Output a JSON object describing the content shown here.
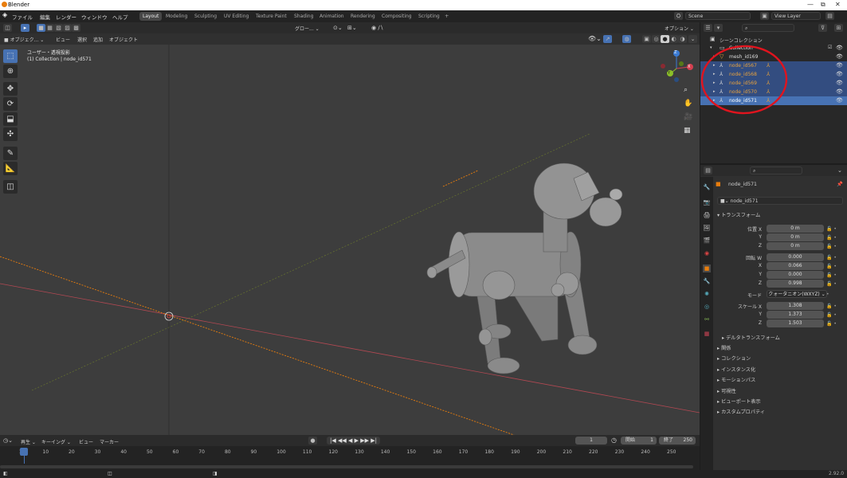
{
  "window": {
    "title": "Blender",
    "minimize": "—",
    "restore": "⧉",
    "close": "✕"
  },
  "menubar": {
    "menus": [
      "ファイル",
      "編集",
      "レンダー",
      "ウィンドウ",
      "ヘルプ"
    ],
    "workspaces": [
      "Layout",
      "Modeling",
      "Sculpting",
      "UV Editing",
      "Texture Paint",
      "Shading",
      "Animation",
      "Rendering",
      "Compositing",
      "Scripting"
    ],
    "add_workspace": "+",
    "scene_label": "Scene",
    "view_layer_label": "View Layer"
  },
  "viewport_header": {
    "mode": "オブジェク...",
    "transform_orientation": "グロー...",
    "overlay_label": "オプション"
  },
  "viewport_menu": {
    "items": [
      "ビュー",
      "選択",
      "追加",
      "オブジェクト"
    ]
  },
  "viewport": {
    "view_name": "ユーザー・透視投影",
    "collection_info": "(1) Collection | node_id571",
    "gizmo_x": "X",
    "gizmo_y": "Y",
    "gizmo_z": "Z"
  },
  "tools": [
    "select-box-icon",
    "cursor-icon",
    "move-icon",
    "rotate-icon",
    "scale-icon",
    "transform-icon",
    "annotate-icon",
    "measure-icon",
    "add-cube-icon"
  ],
  "outliner": {
    "root": "シーンコレクション",
    "rows": [
      {
        "label": "Collection",
        "state": "normal"
      },
      {
        "label": "mesh_id169",
        "state": "normal"
      },
      {
        "label": "node_id567",
        "state": "selected"
      },
      {
        "label": "node_id568",
        "state": "selected"
      },
      {
        "label": "node_id569",
        "state": "selected"
      },
      {
        "label": "node_id570",
        "state": "selected"
      },
      {
        "label": "node_id571",
        "state": "active"
      }
    ],
    "highlight_color": "#e0141e"
  },
  "properties": {
    "object_name": "node_id571",
    "object_data_name": "node_id571",
    "transform_header": "トランスフォーム",
    "location_label": "位置 X",
    "location": [
      "0 m",
      "0 m",
      "0 m"
    ],
    "rotation_label": "回転 W",
    "rotation": [
      "0.000",
      "0.066",
      "0.000",
      "0.998"
    ],
    "axis_labels": [
      "X",
      "Y",
      "Z"
    ],
    "mode_label": "モード",
    "mode_value": "クォータニオン(WXYZ)",
    "scale_label": "スケール X",
    "scale": [
      "1.308",
      "1.373",
      "1.503"
    ],
    "delta_transform": "デルタトランスフォーム",
    "sections": [
      "関係",
      "コレクション",
      "インスタンス化",
      "モーションパス",
      "可視性",
      "ビューポート表示",
      "カスタムプロパティ"
    ]
  },
  "timeline": {
    "menus": [
      "再生",
      "キーイング",
      "ビュー",
      "マーカー"
    ],
    "current_frame": "1",
    "start_label": "開始",
    "start": "1",
    "end_label": "終了",
    "end": "250",
    "ticks": [
      "1",
      "10",
      "20",
      "30",
      "40",
      "50",
      "60",
      "70",
      "80",
      "90",
      "100",
      "110",
      "120",
      "130",
      "140",
      "150",
      "160",
      "170",
      "180",
      "190",
      "200",
      "210",
      "220",
      "230",
      "240",
      "250"
    ]
  },
  "status": {
    "version": "2.92.0"
  },
  "colors": {
    "accent": "#4772b3",
    "x_axis": "#c0404a",
    "y_axis": "#8aa030",
    "selection": "#e87d0d"
  }
}
